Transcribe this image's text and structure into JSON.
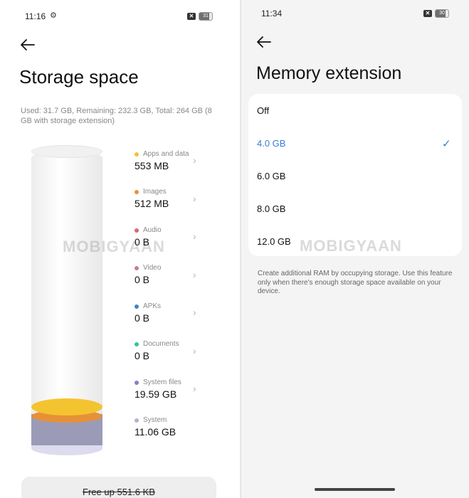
{
  "left": {
    "status_time": "11:16",
    "battery": "31",
    "title": "Storage space",
    "summary": "Used: 31.7 GB, Remaining: 232.3 GB, Total: 264 GB (8 GB with storage extension)",
    "watermark": "MOBIGYAAN",
    "categories": [
      {
        "label": "Apps and data",
        "value": "553 MB",
        "color": "#f1c232"
      },
      {
        "label": "Images",
        "value": "512 MB",
        "color": "#e69138"
      },
      {
        "label": "Audio",
        "value": "0 B",
        "color": "#e06666"
      },
      {
        "label": "Video",
        "value": "0 B",
        "color": "#c27ba0"
      },
      {
        "label": "APKs",
        "value": "0 B",
        "color": "#3d85c6"
      },
      {
        "label": "Documents",
        "value": "0 B",
        "color": "#38c48c"
      },
      {
        "label": "System files",
        "value": "19.59 GB",
        "color": "#8e7cc3"
      },
      {
        "label": "System",
        "value": "11.06 GB",
        "color": "#b4b4c8"
      }
    ],
    "free_up_label": "Free up 551.6 KB"
  },
  "right": {
    "status_time": "11:34",
    "battery": "30",
    "title": "Memory extension",
    "watermark": "MOBIGYAAN",
    "options": [
      {
        "label": "Off",
        "selected": false
      },
      {
        "label": "4.0 GB",
        "selected": true
      },
      {
        "label": "6.0 GB",
        "selected": false
      },
      {
        "label": "8.0 GB",
        "selected": false
      },
      {
        "label": "12.0 GB",
        "selected": false
      }
    ],
    "note": "Create additional RAM by occupying storage. Use this feature only when there's enough storage space available on your device."
  }
}
